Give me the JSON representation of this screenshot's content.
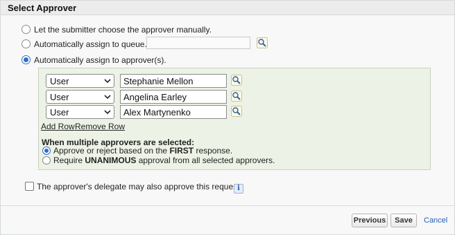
{
  "section": {
    "title": "Select Approver"
  },
  "options": {
    "manual": "Let the submitter choose the approver manually.",
    "queue": "Automatically assign to queue.",
    "approvers": "Automatically assign to approver(s)."
  },
  "selected_option": "approvers",
  "queue_input": {
    "value": ""
  },
  "approver_rows": [
    {
      "type": "User",
      "name": "Stephanie Mellon"
    },
    {
      "type": "User",
      "name": "Angelina Earley"
    },
    {
      "type": "User",
      "name": "Alex Martynenko"
    }
  ],
  "row_actions": {
    "add": "Add Row",
    "remove": "Remove Row"
  },
  "multiple": {
    "title": "When multiple approvers are selected:",
    "first_prefix": "Approve or reject based on the ",
    "first_bold": "FIRST",
    "first_suffix": " response.",
    "unanimous_prefix": "Require ",
    "unanimous_bold": "UNANIMOUS",
    "unanimous_suffix": " approval from all selected approvers.",
    "selected": "first"
  },
  "delegate": {
    "label": "The approver's delegate may also approve this request.",
    "checked": false
  },
  "info_icon": "i",
  "footer": {
    "previous": "Previous",
    "save": "Save",
    "cancel": "Cancel"
  },
  "icons": {
    "lookup": "lookup-magnifier-icon",
    "info": "info-icon",
    "chevron": "chevron-down-icon"
  },
  "colors": {
    "accent": "#2d6ec9",
    "assign_bg": "#edf2e6",
    "link": "#1f5fb8"
  }
}
